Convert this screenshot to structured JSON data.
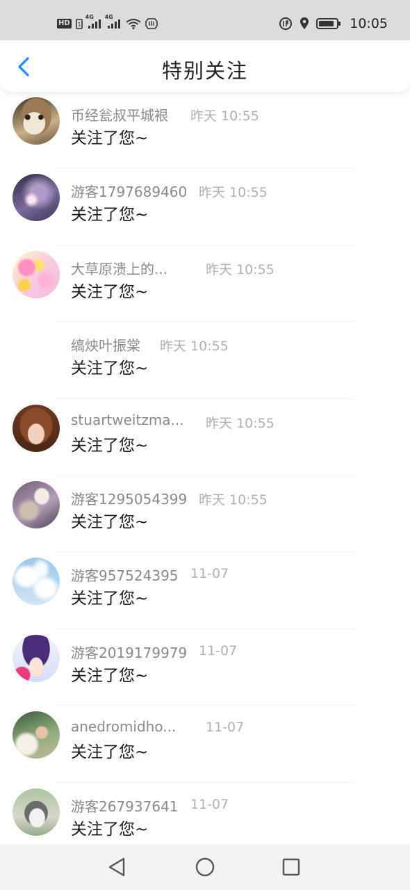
{
  "status_bar": {
    "left_hd": "HD",
    "sim1_label": "4G",
    "sim2_label": "4G",
    "time": "10:05"
  },
  "header": {
    "title": "特别关注",
    "back_icon": "chevron-left-icon",
    "accent_color": "#1e90ff"
  },
  "follows": [
    {
      "name": "币经瓮叔平城裉",
      "time": "昨天 10:55",
      "message": "关注了您~",
      "avatar": "cat"
    },
    {
      "name": "游客1797689460",
      "time": "昨天 10:55",
      "message": "关注了您~",
      "avatar": "moon"
    },
    {
      "name": "大草原溃上的...",
      "time": "昨天 10:55",
      "message": "关注了您~",
      "avatar": "flowers"
    },
    {
      "name": "缟炴叶振棠",
      "time": "昨天 10:55",
      "message": "关注了您~",
      "avatar": "none"
    },
    {
      "name": "stuartweitzma...",
      "time": "昨天 10:55",
      "message": "关注了您~",
      "avatar": "girl"
    },
    {
      "name": "游客1295054399",
      "time": "昨天 10:55",
      "message": "关注了您~",
      "avatar": "toy"
    },
    {
      "name": "游客957524395",
      "time": "11-07",
      "message": "关注了您~",
      "avatar": "sky"
    },
    {
      "name": "游客2019179979",
      "time": "11-07",
      "message": "关注了您~",
      "avatar": "anime"
    },
    {
      "name": "anedromidho...",
      "time": "11-07",
      "message": "关注了您~",
      "avatar": "woman"
    },
    {
      "name": "游客267937641",
      "time": "11-07",
      "message": "关注了您~",
      "avatar": "dog"
    }
  ],
  "nav": {
    "back_icon": "triangle-back-icon",
    "home_icon": "circle-home-icon",
    "recent_icon": "square-recent-icon"
  }
}
